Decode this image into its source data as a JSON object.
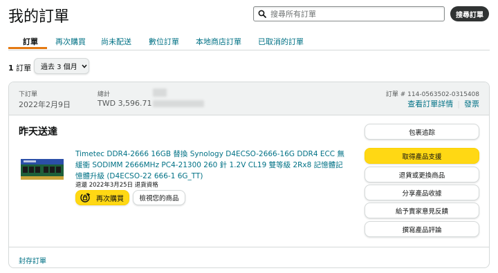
{
  "header": {
    "title": "我的訂單",
    "search": {
      "placeholder": "搜尋所有訂單",
      "value": ""
    },
    "search_button": "搜尋訂單"
  },
  "tabs": [
    {
      "label": "訂單",
      "active": true
    },
    {
      "label": "再次購買"
    },
    {
      "label": "尚未配送"
    },
    {
      "label": "數位訂單"
    },
    {
      "label": "本地商店訂單"
    },
    {
      "label": "已取消的訂單"
    }
  ],
  "filter": {
    "count_number": "1",
    "count_suffix": " 訂單",
    "period": "過去 3 個月"
  },
  "order": {
    "placed_label": "下訂單",
    "placed_value": "2022年2月9日",
    "total_label": "總計",
    "total_value": "TWD 3,596.71",
    "order_number": "訂單 # 114-0563502-0315408",
    "details_link": "查看訂單詳情",
    "invoice_link": "發票",
    "status": "昨天送達",
    "product_title": "Timetec DDR4-2666 16GB 替換 Synology D4ECSO-2666-16G DDR4 ECC 無緩衝 SODIMM 2666MHz PC4-21300 260 針 1.2V CL19 雙等級 2Rx8 記憶體記憶體升級 (D4ECSO-22 666-1 6G_TT)",
    "return_note": "退還 2022年3月25日 退貨資格",
    "buy_again": "再次購買",
    "view_item": "檢視您的商品",
    "actions": [
      {
        "label": "包裹追踪",
        "primary": false
      },
      {
        "label": "取得產品支援",
        "primary": true
      },
      {
        "label": "退貨或更換商品",
        "primary": false
      },
      {
        "label": "分享產品收據",
        "primary": false
      },
      {
        "label": "給予賣家意見反饋",
        "primary": false
      },
      {
        "label": "撰寫產品評論",
        "primary": false
      }
    ],
    "archive_link": "封存訂單"
  },
  "colors": {
    "link": "#007185",
    "primary_button": "#ffd814",
    "tab_underline": "#e47911",
    "header_bg": "#f0f2f2"
  }
}
